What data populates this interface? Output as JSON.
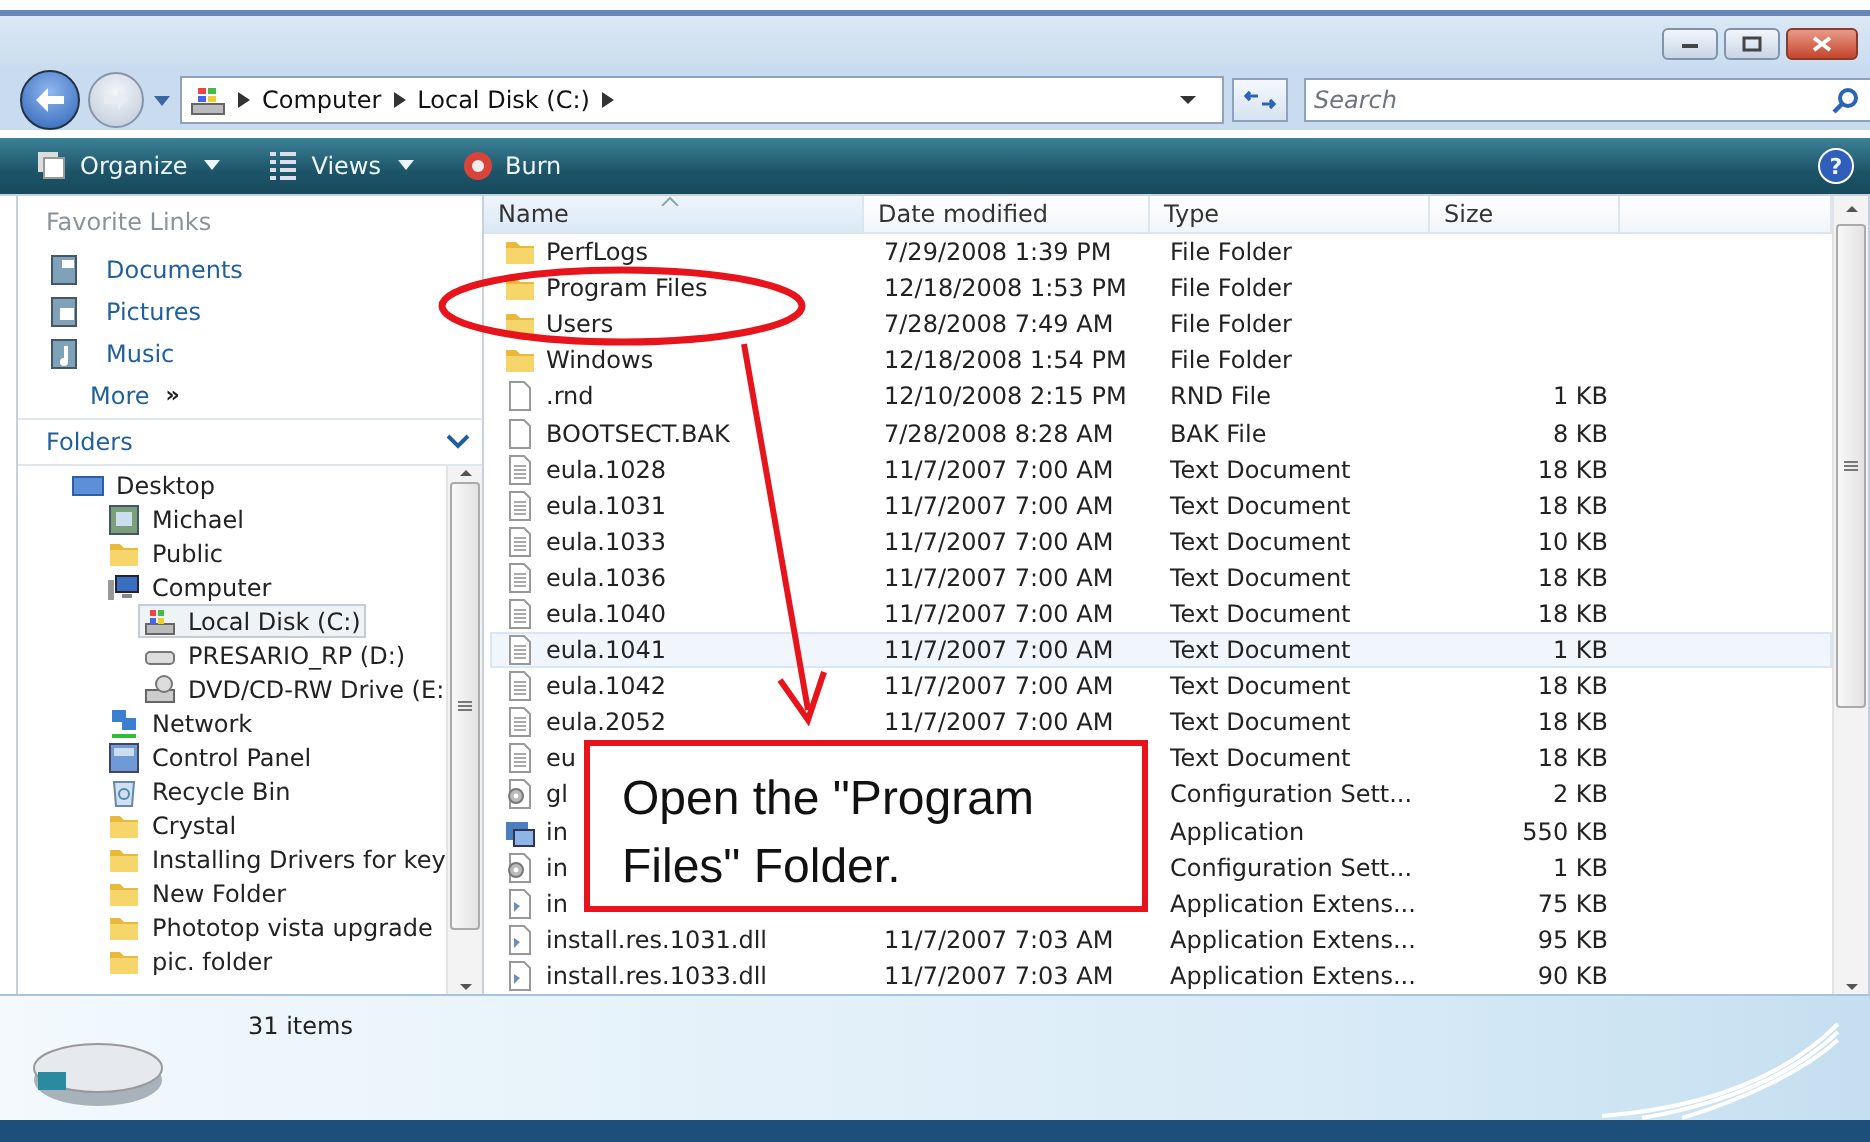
{
  "address_bar": {
    "breadcrumb": [
      "Computer",
      "Local Disk (C:)"
    ]
  },
  "search": {
    "placeholder": "Search"
  },
  "toolbar": [
    {
      "label": "Organize",
      "dropdown": true
    },
    {
      "label": "Views",
      "dropdown": true
    },
    {
      "label": "Burn",
      "dropdown": false
    }
  ],
  "help_button": {
    "glyph": "?"
  },
  "favorite_links": {
    "title": "Favorite Links",
    "items": [
      {
        "label": "Documents",
        "kind": "documents"
      },
      {
        "label": "Pictures",
        "kind": "pictures"
      },
      {
        "label": "Music",
        "kind": "music"
      }
    ],
    "more": {
      "label": "More",
      "glyph": "»"
    }
  },
  "folders": {
    "title": "Folders",
    "tree": [
      {
        "label": "Desktop",
        "kind": "desktop",
        "selected": false,
        "children": [
          {
            "label": "Michael",
            "kind": "user",
            "selected": false
          },
          {
            "label": "Public",
            "kind": "folder",
            "selected": false
          },
          {
            "label": "Computer",
            "kind": "computer",
            "selected": false,
            "children": [
              {
                "label": "Local Disk (C:)",
                "kind": "system-drive",
                "selected": true
              },
              {
                "label": "PRESARIO_RP (D:)",
                "kind": "drive",
                "selected": false
              },
              {
                "label": "DVD/CD-RW Drive (E:",
                "kind": "optical-drive",
                "selected": false
              }
            ]
          },
          {
            "label": "Network",
            "kind": "network",
            "selected": false
          },
          {
            "label": "Control Panel",
            "kind": "control-panel",
            "selected": false
          },
          {
            "label": "Recycle Bin",
            "kind": "recycle-bin",
            "selected": false
          },
          {
            "label": "Crystal",
            "kind": "folder",
            "selected": false
          },
          {
            "label": "Installing Drivers for key",
            "kind": "folder",
            "selected": false
          },
          {
            "label": "New Folder",
            "kind": "folder",
            "selected": false
          },
          {
            "label": "Phototop vista upgrade",
            "kind": "folder",
            "selected": false
          },
          {
            "label": "pic. folder",
            "kind": "folder",
            "selected": false
          }
        ]
      }
    ]
  },
  "file_list": {
    "columns": [
      "Name",
      "Date modified",
      "Type",
      "Size"
    ],
    "rows": [
      {
        "name": "PerfLogs",
        "date": "7/29/2008 1:39 PM",
        "type": "File Folder",
        "size": "",
        "kind": "folder",
        "hovered": false
      },
      {
        "name": "Program Files",
        "date": "12/18/2008 1:53 PM",
        "type": "File Folder",
        "size": "",
        "kind": "folder",
        "hovered": false
      },
      {
        "name": "Users",
        "date": "7/28/2008 7:49 AM",
        "type": "File Folder",
        "size": "",
        "kind": "folder",
        "hovered": false
      },
      {
        "name": "Windows",
        "date": "12/18/2008 1:54 PM",
        "type": "File Folder",
        "size": "",
        "kind": "folder",
        "hovered": false
      },
      {
        "name": ".rnd",
        "date": "12/10/2008 2:15 PM",
        "type": "RND File",
        "size": "1 KB",
        "kind": "file",
        "hovered": false
      },
      {
        "name": "BOOTSECT.BAK",
        "date": "7/28/2008 8:28 AM",
        "type": "BAK File",
        "size": "8 KB",
        "kind": "file",
        "hovered": false
      },
      {
        "name": "eula.1028",
        "date": "11/7/2007 7:00 AM",
        "type": "Text Document",
        "size": "18 KB",
        "kind": "text",
        "hovered": false
      },
      {
        "name": "eula.1031",
        "date": "11/7/2007 7:00 AM",
        "type": "Text Document",
        "size": "18 KB",
        "kind": "text",
        "hovered": false
      },
      {
        "name": "eula.1033",
        "date": "11/7/2007 7:00 AM",
        "type": "Text Document",
        "size": "10 KB",
        "kind": "text",
        "hovered": false
      },
      {
        "name": "eula.1036",
        "date": "11/7/2007 7:00 AM",
        "type": "Text Document",
        "size": "18 KB",
        "kind": "text",
        "hovered": false
      },
      {
        "name": "eula.1040",
        "date": "11/7/2007 7:00 AM",
        "type": "Text Document",
        "size": "18 KB",
        "kind": "text",
        "hovered": false
      },
      {
        "name": "eula.1041",
        "date": "11/7/2007 7:00 AM",
        "type": "Text Document",
        "size": "1 KB",
        "kind": "text",
        "hovered": true
      },
      {
        "name": "eula.1042",
        "date": "11/7/2007 7:00 AM",
        "type": "Text Document",
        "size": "18 KB",
        "kind": "text",
        "hovered": false
      },
      {
        "name": "eula.2052",
        "date": "11/7/2007 7:00 AM",
        "type": "Text Document",
        "size": "18 KB",
        "kind": "text",
        "hovered": false
      },
      {
        "name": "eu",
        "date": "",
        "type": "Text Document",
        "size": "18 KB",
        "kind": "text",
        "hovered": false
      },
      {
        "name": "gl",
        "date": "",
        "type": "Configuration Sett...",
        "size": "2 KB",
        "kind": "config",
        "hovered": false
      },
      {
        "name": "in",
        "date": "",
        "type": "Application",
        "size": "550 KB",
        "kind": "app",
        "hovered": false
      },
      {
        "name": "in",
        "date": "",
        "type": "Configuration Sett...",
        "size": "1 KB",
        "kind": "config",
        "hovered": false
      },
      {
        "name": "in",
        "date": "",
        "type": "Application Extens...",
        "size": "75 KB",
        "kind": "dll",
        "hovered": false
      },
      {
        "name": "install.res.1031.dll",
        "date": "11/7/2007 7:03 AM",
        "type": "Application Extens...",
        "size": "95 KB",
        "kind": "dll",
        "hovered": false
      },
      {
        "name": "install.res.1033.dll",
        "date": "11/7/2007 7:03 AM",
        "type": "Application Extens...",
        "size": "90 KB",
        "kind": "dll",
        "hovered": false
      }
    ]
  },
  "status_bar": {
    "item_count": "31 items"
  },
  "annotation": {
    "callout": "Open the \"Program Files\" Folder."
  }
}
